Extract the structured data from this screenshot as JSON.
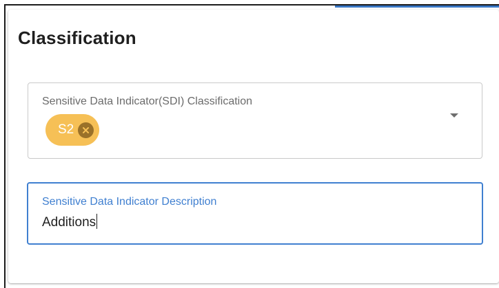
{
  "card": {
    "title": "Classification"
  },
  "sdi_classification": {
    "label": "Sensitive Data Indicator(SDI) Classification",
    "selected_chips": [
      {
        "label": "S2",
        "remove_icon": "close-circle-icon"
      }
    ],
    "dropdown_icon": "arrow-drop-down-icon"
  },
  "sdi_description": {
    "label": "Sensitive Data Indicator Description",
    "value": "Additions"
  },
  "colors": {
    "chip_background": "#f6c056",
    "chip_remove_background": "#9a7129",
    "focus_accent": "#3f7fd0",
    "top_accent": "#3a78c6"
  }
}
